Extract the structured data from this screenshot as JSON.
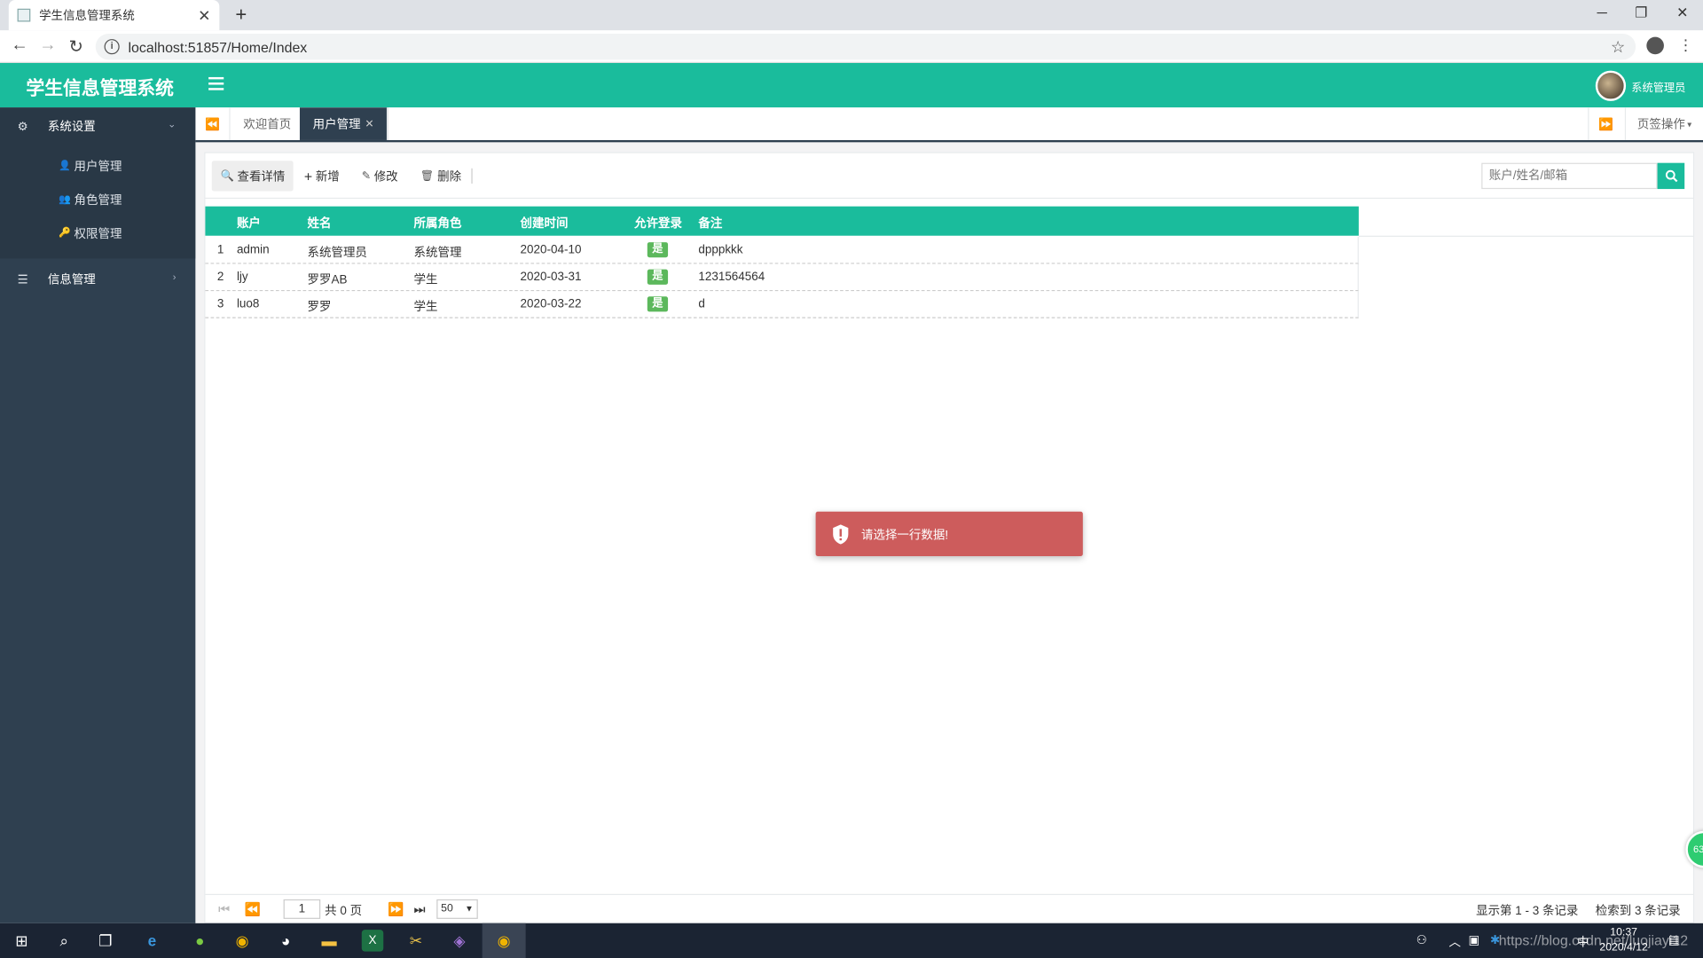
{
  "browser": {
    "tab_title": "学生信息管理系统",
    "url": "localhost:51857/Home/Index"
  },
  "app": {
    "title": "学生信息管理系统",
    "user": "系统管理员"
  },
  "sidebar": {
    "groups": [
      {
        "label": "系统设置",
        "icon": "gears-icon",
        "expanded": true,
        "items": [
          {
            "label": "用户管理",
            "icon": "user-icon"
          },
          {
            "label": "角色管理",
            "icon": "users-icon"
          },
          {
            "label": "权限管理",
            "icon": "key-icon"
          }
        ]
      },
      {
        "label": "信息管理",
        "icon": "database-icon",
        "expanded": false
      }
    ]
  },
  "tabs": {
    "items": [
      "欢迎首页",
      "用户管理"
    ],
    "active": "用户管理",
    "page_ops": "页签操作"
  },
  "toolbar": {
    "view": "查看详情",
    "add": "新增",
    "edit": "修改",
    "delete": "删除",
    "search_placeholder": "账户/姓名/邮箱"
  },
  "grid": {
    "headers": [
      "账户",
      "姓名",
      "所属角色",
      "创建时间",
      "允许登录",
      "备注"
    ],
    "rows": [
      {
        "no": "1",
        "account": "admin",
        "name": "系统管理员",
        "role": "系统管理",
        "created": "2020-04-10",
        "allow": "是",
        "note": "dpppkkk"
      },
      {
        "no": "2",
        "account": "ljy",
        "name": "罗罗AB",
        "role": "学生",
        "created": "2020-03-31",
        "allow": "是",
        "note": "1231564564"
      },
      {
        "no": "3",
        "account": "luo8",
        "name": "罗罗",
        "role": "学生",
        "created": "2020-03-22",
        "allow": "是",
        "note": "d"
      }
    ]
  },
  "pager": {
    "page": "1",
    "total_pages": "共 0 页",
    "page_size": "50",
    "display_info": "显示第 1 - 3 条记录",
    "found_info": "检索到 3 条记录"
  },
  "toast": {
    "message": "请选择一行数据!",
    "color": "#cd5c5c"
  },
  "float_badge": "63",
  "taskbar": {
    "time": "10:37",
    "date": "2020/4/12",
    "tray_ime": "中"
  },
  "watermark": "https://blog.csdn.net/luojiayi12",
  "colors": {
    "accent": "#1abc9c",
    "sidebar": "#2f4050",
    "badge_green": "#5cb85c"
  }
}
